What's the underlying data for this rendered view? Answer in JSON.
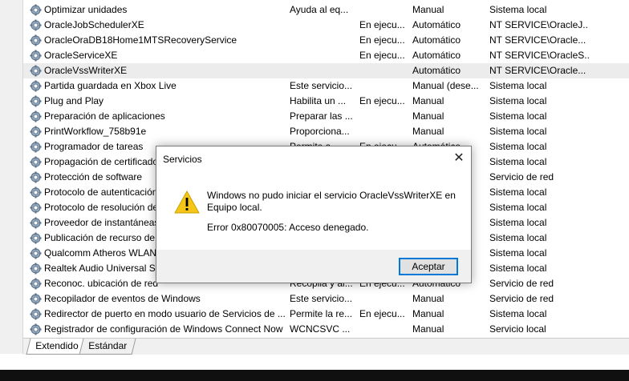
{
  "services": [
    {
      "name": "Optimizar unidades",
      "desc": "Ayuda al eq...",
      "status": "",
      "start": "Manual",
      "logon": "Sistema local"
    },
    {
      "name": "OracleJobSchedulerXE",
      "desc": "",
      "status": "En ejecu...",
      "start": "Automático",
      "logon": "NT SERVICE\\OracleJ..."
    },
    {
      "name": "OracleOraDB18Home1MTSRecoveryService",
      "desc": "",
      "status": "En ejecu...",
      "start": "Automático",
      "logon": "NT SERVICE\\Oracle..."
    },
    {
      "name": "OracleServiceXE",
      "desc": "",
      "status": "En ejecu...",
      "start": "Automático",
      "logon": "NT SERVICE\\OracleS..."
    },
    {
      "name": "OracleVssWriterXE",
      "desc": "",
      "status": "",
      "start": "Automático",
      "logon": "NT SERVICE\\Oracle...",
      "selected": true
    },
    {
      "name": "Partida guardada en Xbox Live",
      "desc": "Este servicio...",
      "status": "",
      "start": "Manual (dese...",
      "logon": "Sistema local"
    },
    {
      "name": "Plug and Play",
      "desc": "Habilita un ...",
      "status": "En ejecu...",
      "start": "Manual",
      "logon": "Sistema local"
    },
    {
      "name": "Preparación de aplicaciones",
      "desc": "Preparar las ...",
      "status": "",
      "start": "Manual",
      "logon": "Sistema local"
    },
    {
      "name": "PrintWorkflow_758b91e",
      "desc": "Proporciona...",
      "status": "",
      "start": "Manual",
      "logon": "Sistema local"
    },
    {
      "name": "Programador de tareas",
      "desc": "Permite a ...",
      "status": "En ejecu...",
      "start": "Automático",
      "logon": "Sistema local"
    },
    {
      "name": "Propagación de certificado",
      "desc": "",
      "status": "",
      "start": "",
      "logon": "Sistema local"
    },
    {
      "name": "Protección de software",
      "desc": "",
      "status": "",
      "start": "",
      "logon": "Servicio de red"
    },
    {
      "name": "Protocolo de autenticación",
      "desc": "",
      "status": "",
      "start": "",
      "logon": "Sistema local"
    },
    {
      "name": "Protocolo de resolución de",
      "desc": "",
      "status": "",
      "start": "",
      "logon": "Sistema local"
    },
    {
      "name": "Proveedor de instantáneas",
      "desc": "",
      "status": "",
      "start": "",
      "logon": "Sistema local"
    },
    {
      "name": "Publicación de recurso de",
      "desc": "",
      "status": "",
      "start": "",
      "logon": "Sistema local"
    },
    {
      "name": "Qualcomm Atheros WLAN",
      "desc": "",
      "status": "",
      "start": "",
      "logon": "Sistema local"
    },
    {
      "name": "Realtek Audio Universal Se",
      "desc": "",
      "status": "",
      "start": "",
      "logon": "Sistema local"
    },
    {
      "name": "Reconoc. ubicación de red",
      "desc": "Recopila y al...",
      "status": "En ejecu...",
      "start": "Automático",
      "logon": "Servicio de red"
    },
    {
      "name": "Recopilador de eventos de Windows",
      "desc": "Este servicio...",
      "status": "",
      "start": "Manual",
      "logon": "Servicio de red"
    },
    {
      "name": "Redirector de puerto en modo usuario de Servicios de ...",
      "desc": "Permite la re...",
      "status": "En ejecu...",
      "start": "Manual",
      "logon": "Sistema local"
    },
    {
      "name": "Registrador de configuración de Windows Connect Now",
      "desc": "WCNCSVC ...",
      "status": "",
      "start": "Manual",
      "logon": "Servicio local"
    }
  ],
  "tabs": [
    "Extendido",
    "Estándar"
  ],
  "dialog": {
    "title": "Servicios",
    "close": "✕",
    "message": "Windows no pudo iniciar el servicio OracleVssWriterXE en Equipo local.",
    "error": "Error 0x80070005: Acceso denegado.",
    "ok_label": "Aceptar"
  },
  "colors": {
    "selected_row": "#ececec",
    "accent": "#0078d7",
    "warning": "#f5c518"
  }
}
